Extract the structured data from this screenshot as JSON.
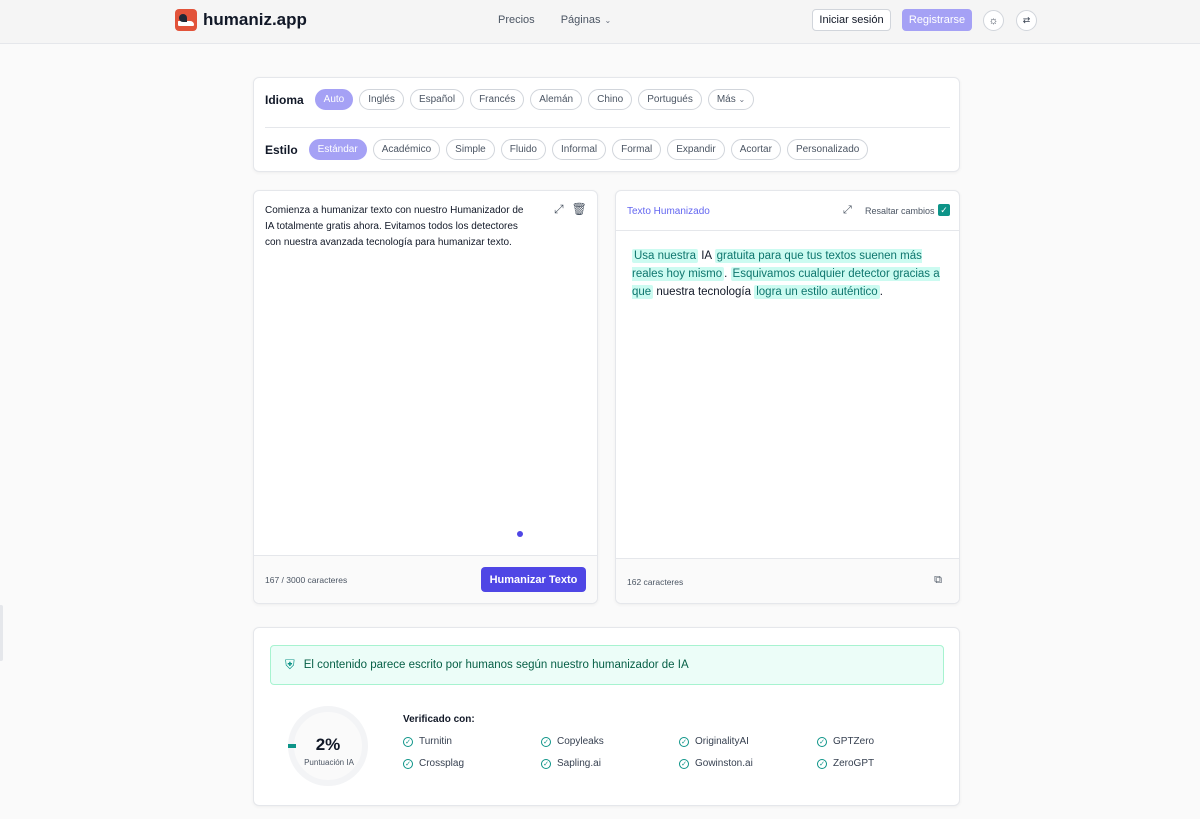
{
  "header": {
    "brand": "humaniz.app",
    "nav": [
      {
        "label": "Precios"
      },
      {
        "label": "Páginas"
      }
    ],
    "login_label": "Iniciar sesión",
    "register_label": "Registrarse"
  },
  "options": {
    "language_label": "Idioma",
    "languages": [
      "Auto",
      "Inglés",
      "Español",
      "Francés",
      "Alemán",
      "Chino",
      "Portugués",
      "Más"
    ],
    "language_active": "Auto",
    "style_label": "Estilo",
    "styles": [
      "Estándar",
      "Académico",
      "Simple",
      "Fluido",
      "Informal",
      "Formal",
      "Expandir",
      "Acortar",
      "Personalizado"
    ],
    "style_active": "Estándar"
  },
  "editor": {
    "text": "Comienza a humanizar texto con nuestro Humanizador de IA totalmente gratis ahora. Evitamos todos los detectores con nuestra avanzada tecnología para humanizar texto.",
    "char_count": "167 / 3000 caracteres",
    "humanize_label": "Humanizar Texto"
  },
  "output": {
    "title": "Texto Humanizado",
    "highlight_label": "Resaltar cambios",
    "highlight_checked": true,
    "segments": [
      {
        "text": "Usa nuestra",
        "hl": true
      },
      {
        "text": "IA",
        "hl": false
      },
      {
        "text": "gratuita para que tus textos suenen más reales hoy mismo",
        "hl": true
      },
      {
        "text": ".",
        "hl": false
      },
      {
        "text": "Esquivamos cualquier detector gracias a que",
        "hl": true
      },
      {
        "text": "nuestra tecnología",
        "hl": false
      },
      {
        "text": "logra un estilo auténtico",
        "hl": true
      },
      {
        "text": ".",
        "hl": false
      }
    ],
    "char_count": "162 caracteres"
  },
  "result": {
    "alert": "El contenido parece escrito por humanos según nuestro humanizador de IA",
    "score": "2%",
    "score_value": 2,
    "score_label": "Puntuación IA",
    "verified_title": "Verificado con:",
    "detectors": [
      "Turnitin",
      "Copyleaks",
      "OriginalityAI",
      "GPTZero",
      "Crossplag",
      "Sapling.ai",
      "Gowinston.ai",
      "ZeroGPT"
    ]
  },
  "colors": {
    "accent": "#4f46e5",
    "accent_light": "#a5a1f5",
    "teal": "#0d9488",
    "highlight_bg": "#ccfbf1"
  }
}
